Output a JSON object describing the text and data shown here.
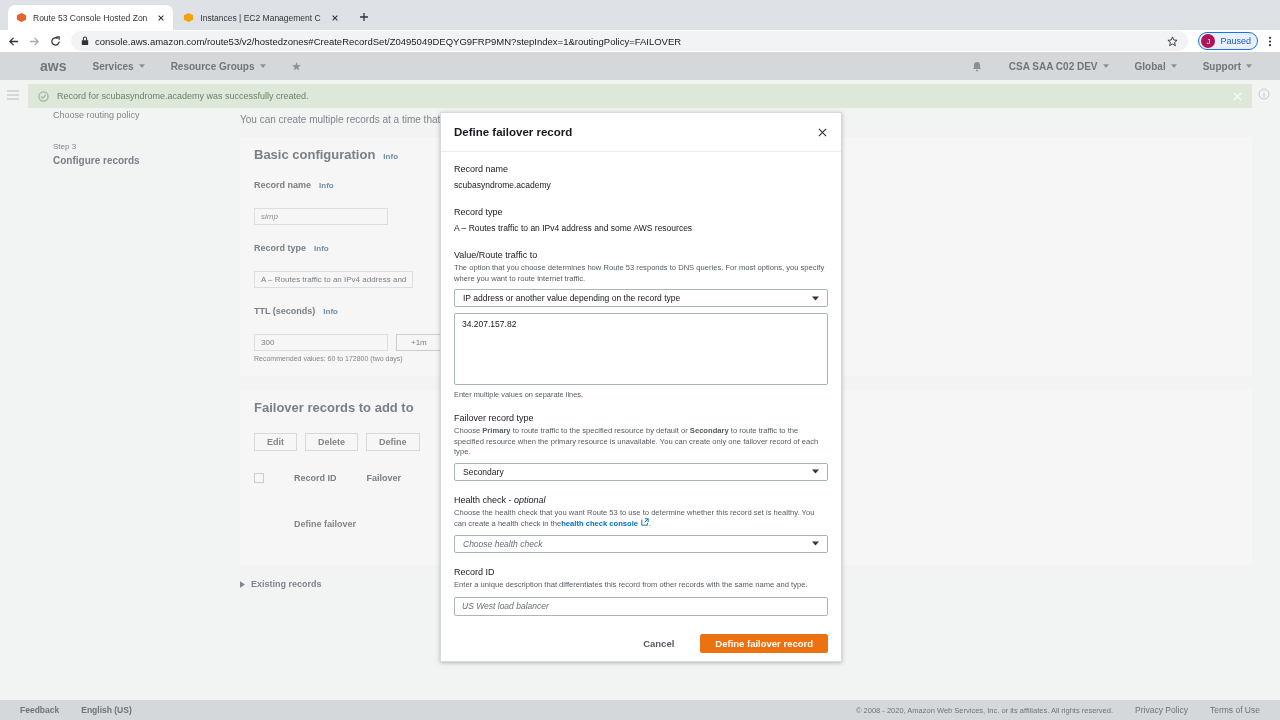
{
  "browser": {
    "tabs": [
      {
        "title": "Route 53 Console Hosted Zon",
        "selected": true
      },
      {
        "title": "Instances | EC2 Management C",
        "selected": false
      }
    ],
    "url": "console.aws.amazon.com/route53/v2/hostedzones#CreateRecordSet/Z0495049DEQYG9FRP9MN?stepIndex=1&routingPolicy=FAILOVER",
    "profile": {
      "initial": "J",
      "status": "Paused"
    }
  },
  "aws_nav": {
    "logo": "aws",
    "items": [
      "Services",
      "Resource Groups"
    ],
    "right": [
      "CSA SAA C02 DEV",
      "Global",
      "Support"
    ]
  },
  "flash": {
    "message": "Record for scubasyndrome.academy was successfully created."
  },
  "sidebar": {
    "items": [
      {
        "text": "Choose routing policy",
        "kind": "title"
      },
      {
        "text": "Step 3",
        "kind": "step"
      },
      {
        "text": "Configure records",
        "kind": "current"
      }
    ]
  },
  "main": {
    "intro": "You can create multiple records at a time that",
    "basic": {
      "title": "Basic configuration",
      "info": "Info",
      "fields": [
        {
          "label": "Record name",
          "info": "Info",
          "placeholder": "simp"
        },
        {
          "label": "Record type",
          "info": "Info",
          "value": "A – Routes traffic to an IPv4 address and"
        },
        {
          "label": "TTL (seconds)",
          "info": "Info",
          "value": "300",
          "button": "+1m",
          "hint": "Recommended values: 60 to 172800 (two days)"
        }
      ]
    },
    "failover": {
      "title": "Failover records to add to",
      "buttons": [
        "Edit",
        "Delete",
        "Define"
      ],
      "all_checked": false,
      "columns": [
        "Record ID",
        "Failover"
      ],
      "empty": "Define failover"
    },
    "existing": "Existing records"
  },
  "footer": {
    "feedback": "Feedback",
    "language": "English (US)",
    "copyright": "© 2008 - 2020, Amazon Web Services, Inc. or its affiliates. All rights reserved.",
    "links": [
      "Privacy Policy",
      "Terms of Use"
    ]
  },
  "modal": {
    "title": "Define failover record",
    "fields": [
      {
        "kind": "static",
        "label": "Record name",
        "value": "scubasyndrome.academy"
      },
      {
        "kind": "static",
        "label": "Record type",
        "value": "A – Routes traffic to an IPv4 address and some AWS resources"
      },
      {
        "kind": "select_textarea",
        "label": "Value/Route traffic to",
        "description": "The option that you choose determines how Route 53 responds to DNS queries. For most options, you specify where you want to route internet traffic.",
        "select": "IP address or another value depending on the record type",
        "value": "34.207.157.82",
        "hint": "Enter multiple values on separate lines."
      },
      {
        "kind": "select",
        "label": "Failover record type",
        "description": "Choose **Primary** to route traffic to the specified resource by default or **Secondary** to route traffic to the specified resource when the primary resource is unavailable. You can create only one failover record of each type.",
        "value": "Secondary"
      },
      {
        "kind": "select",
        "label": "Health check - *optional*",
        "description": "Choose the health check that you want Route 53 to use to determine whether this record set is healthy. You can create a health check in the",
        "link": "health check console",
        "link_suffix": ".",
        "placeholder": "Choose health check"
      },
      {
        "kind": "input",
        "label": "Record ID",
        "description": "Enter a unique description that differentiates this record from other records with the same name and type.",
        "placeholder": "US West load balancer"
      }
    ],
    "buttons": [
      {
        "label": "Cancel",
        "kind": "link"
      },
      {
        "label": "Define failover record",
        "kind": "primary"
      }
    ]
  }
}
